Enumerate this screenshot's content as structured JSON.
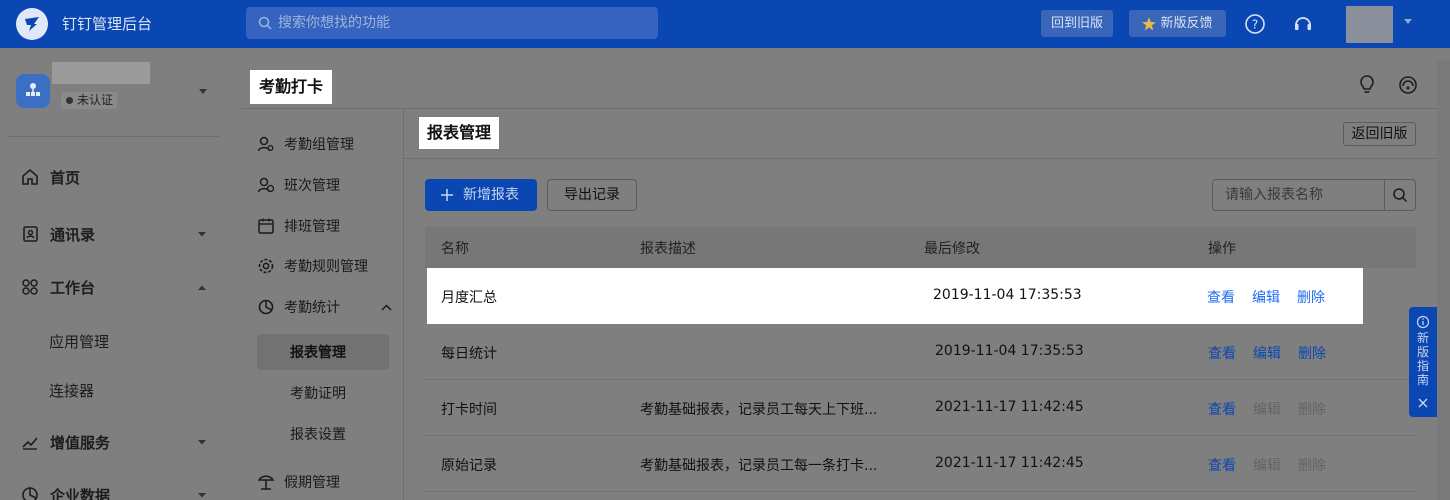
{
  "topbar": {
    "app_title": "钉钉管理后台",
    "search_placeholder": "搜索你想找的功能",
    "old_version_label": "回到旧版",
    "feedback_label": "新版反馈",
    "icons": [
      "dingtalk-logo-icon",
      "search-icon",
      "help-icon",
      "support-headset-icon",
      "chevron-down-icon"
    ]
  },
  "sidebar": {
    "org_status": "未认证",
    "items": [
      {
        "label": "首页",
        "icon": "home-icon"
      },
      {
        "label": "通讯录",
        "icon": "contacts-icon",
        "arrow": "down"
      },
      {
        "label": "工作台",
        "icon": "workbench-icon",
        "arrow": "up"
      },
      {
        "label": "应用管理"
      },
      {
        "label": "连接器"
      },
      {
        "label": "增值服务",
        "icon": "chart-icon",
        "arrow": "down"
      },
      {
        "label": "企业数据",
        "icon": "data-icon",
        "arrow": "down"
      }
    ]
  },
  "breadcrumb": {
    "title": "考勤打卡"
  },
  "subnav": {
    "items": [
      {
        "label": "考勤组管理",
        "icon": "group-icon"
      },
      {
        "label": "班次管理",
        "icon": "shift-icon"
      },
      {
        "label": "排班管理",
        "icon": "calendar-icon"
      },
      {
        "label": "考勤规则管理",
        "icon": "gear-icon"
      },
      {
        "label": "考勤统计",
        "icon": "stats-icon",
        "arrow": "up"
      },
      {
        "label": "报表管理",
        "active": true
      },
      {
        "label": "考勤证明"
      },
      {
        "label": "报表设置"
      },
      {
        "label": "假期管理",
        "icon": "holiday-icon"
      }
    ]
  },
  "content": {
    "title": "报表管理",
    "back_label": "返回旧版",
    "add_label": "新增报表",
    "export_label": "导出记录",
    "search_placeholder": "请输入报表名称",
    "columns": [
      "名称",
      "报表描述",
      "最后修改",
      "操作"
    ],
    "rows": [
      {
        "name": "月度汇总",
        "desc": "",
        "modified": "2019-11-04 17:35:53",
        "view": "查看",
        "edit": "编辑",
        "delete": "删除",
        "edit_enabled": true,
        "delete_enabled": true
      },
      {
        "name": "每日统计",
        "desc": "",
        "modified": "2019-11-04 17:35:53",
        "view": "查看",
        "edit": "编辑",
        "delete": "删除",
        "edit_enabled": true,
        "delete_enabled": true
      },
      {
        "name": "打卡时间",
        "desc": "考勤基础报表，记录员工每天上下班...",
        "modified": "2021-11-17 11:42:45",
        "view": "查看",
        "edit": "编辑",
        "delete": "删除",
        "edit_enabled": false,
        "delete_enabled": false
      },
      {
        "name": "原始记录",
        "desc": "考勤基础报表，记录员工每一条打卡...",
        "modified": "2021-11-17 11:42:45",
        "view": "查看",
        "edit": "编辑",
        "delete": "删除",
        "edit_enabled": false,
        "delete_enabled": false
      }
    ]
  },
  "guide": {
    "label": "新版指南"
  },
  "colors": {
    "brand": "#0b47b3",
    "link": "#1f6cf0",
    "overlay": "#7f7f7f",
    "highlight": "#ffffff"
  }
}
